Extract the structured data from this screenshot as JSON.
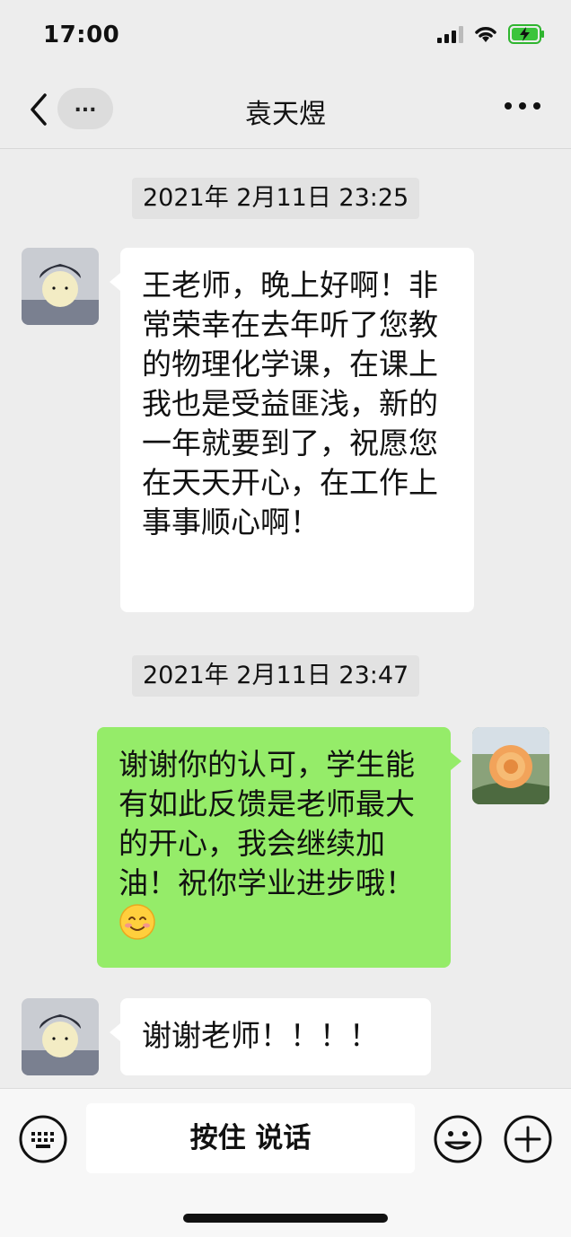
{
  "status_bar": {
    "time": "17:00"
  },
  "nav": {
    "title": "袁天煜",
    "unread_label": "..."
  },
  "messages": [
    {
      "type": "timestamp",
      "text": "2021年 2月11日 23:25"
    },
    {
      "type": "received",
      "text": "王老师，晚上好啊！非常荣幸在去年听了您教的物理化学课，在课上我也是受益匪浅，新的一年就要到了，祝愿您在天天开心，在工作上事事顺心啊！"
    },
    {
      "type": "timestamp",
      "text": "2021年 2月11日 23:47"
    },
    {
      "type": "sent",
      "text": "谢谢你的认可，学生能有如此反馈是老师最大的开心，我会继续加油！祝你学业进步哦！",
      "emoji": "smile-emoji"
    },
    {
      "type": "received",
      "text": "谢谢老师！！！！"
    }
  ],
  "input_bar": {
    "talk_label": "按住 说话"
  },
  "icons": {
    "back": "back-icon",
    "more": "more-icon",
    "keyboard": "keyboard-icon",
    "emoji": "emoji-icon",
    "plus": "plus-icon",
    "wifi": "wifi-icon",
    "battery": "battery-charging-icon",
    "signal": "signal-icon"
  },
  "colors": {
    "background": "#ededed",
    "sent_bubble": "#95ec69",
    "received_bubble": "#ffffff"
  }
}
